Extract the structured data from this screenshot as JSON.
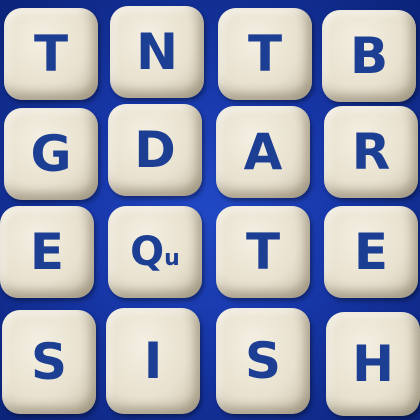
{
  "board": {
    "rows": [
      [
        "T",
        "N",
        "T",
        "B"
      ],
      [
        "G",
        "D",
        "A",
        "R"
      ],
      [
        "E",
        "Qu",
        "T",
        "E"
      ],
      [
        "S",
        "I",
        "S",
        "H"
      ]
    ]
  },
  "colors": {
    "tray": "#1737a8",
    "die": "#ece6d4",
    "letter": "#1c3f94"
  }
}
